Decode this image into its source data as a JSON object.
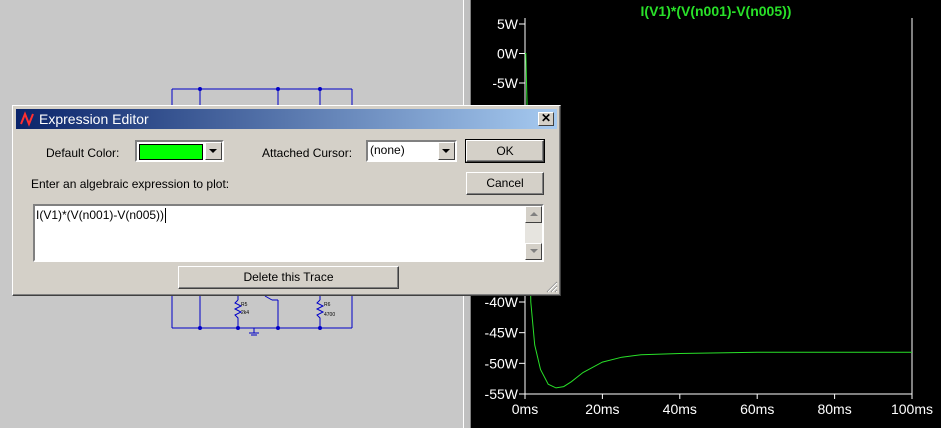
{
  "dialog": {
    "title": "Expression Editor",
    "close_symbol": "✕",
    "default_color_label": "Default Color:",
    "default_color_value": "#00ff00",
    "attached_cursor_label": "Attached Cursor:",
    "attached_cursor_value": "(none)",
    "ok_label": "OK",
    "cancel_label": "Cancel",
    "prompt_label": "Enter an algebraic expression to plot:",
    "expression_value": "I(V1)*(V(n001)-V(n005))",
    "delete_label": "Delete this Trace"
  },
  "schematic": {
    "resistor_labels": [
      {
        "ref": "R5",
        "value": "2k4"
      },
      {
        "ref": "R6",
        "value": "4700"
      }
    ],
    "wire_color": "#0000c8"
  },
  "plot": {
    "title": "I(V1)*(V(n001)-V(n005))",
    "trace_color": "#29e029",
    "background": "#000000"
  },
  "chart_data": {
    "type": "line",
    "title": "I(V1)*(V(n001)-V(n005))",
    "xlabel": "",
    "ylabel": "",
    "x_unit": "ms",
    "y_unit": "W",
    "xlim": [
      0,
      100
    ],
    "ylim": [
      -55,
      5
    ],
    "x_ticks": [
      "0ms",
      "20ms",
      "40ms",
      "60ms",
      "80ms",
      "100ms"
    ],
    "x_tick_values": [
      0,
      20,
      40,
      60,
      80,
      100
    ],
    "y_ticks": [
      "5W",
      "0W",
      "-5W",
      "-40W",
      "-45W",
      "-50W",
      "-55W"
    ],
    "y_tick_values": [
      5,
      0,
      -5,
      -40,
      -45,
      -50,
      -55
    ],
    "grid": false,
    "series": [
      {
        "name": "I(V1)*(V(n001)-V(n005))",
        "color": "#29e029",
        "x": [
          0,
          0.2,
          0.6,
          1.5,
          2.5,
          4,
          6,
          8,
          10,
          12,
          15,
          20,
          25,
          30,
          40,
          50,
          60,
          70,
          80,
          90,
          100
        ],
        "y": [
          0,
          0,
          -10,
          -40,
          -47,
          -51,
          -53.4,
          -54,
          -53.8,
          -53,
          -51.5,
          -49.8,
          -49,
          -48.6,
          -48.4,
          -48.3,
          -48.2,
          -48.2,
          -48.2,
          -48.2,
          -48.2
        ]
      }
    ]
  }
}
